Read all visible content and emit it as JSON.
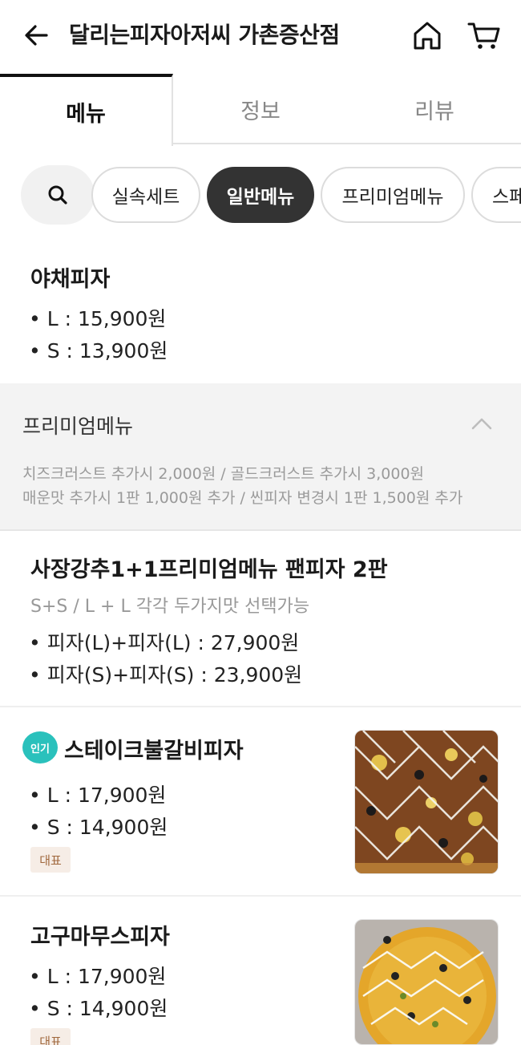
{
  "header": {
    "title": "달리는피자아저씨 가촌증산점",
    "back_icon": "arrow-left-icon",
    "home_icon": "home-icon",
    "cart_icon": "cart-icon"
  },
  "tabs": [
    {
      "label": "메뉴",
      "active": true
    },
    {
      "label": "정보",
      "active": false
    },
    {
      "label": "리뷰",
      "active": false
    }
  ],
  "chips": {
    "search_icon": "search-icon",
    "items": [
      {
        "label": "실속세트",
        "selected": false
      },
      {
        "label": "일반메뉴",
        "selected": true
      },
      {
        "label": "프리미엄메뉴",
        "selected": false
      },
      {
        "label": "스페",
        "selected": false
      }
    ]
  },
  "menu_top": {
    "name": "야채피자",
    "prices": [
      "• L : 15,900원",
      "• S : 13,900원"
    ]
  },
  "section": {
    "title": "프리미엄메뉴",
    "collapse_icon": "chevron-up-icon",
    "notes": [
      "치즈크러스트 추가시 2,000원 / 골드크러스트 추가시 3,000원",
      "매운맛 추가시 1판 1,000원 추가 / 씬피자 변경시 1판 1,500원 추가"
    ]
  },
  "items": [
    {
      "name": "사장강추1+1프리미엄메뉴 팬피자 2판",
      "desc": "S+S / L + L  각각 두가지맛 선택가능",
      "prices": [
        "• 피자(L)+피자(L) : 27,900원",
        "• 피자(S)+피자(S) : 23,900원"
      ]
    },
    {
      "badge": "인기",
      "name": "스테이크불갈비피자",
      "prices": [
        "• L : 17,900원",
        "• S : 14,900원"
      ],
      "tag": "대표"
    },
    {
      "name": "고구마무스피자",
      "prices": [
        "• L : 17,900원",
        "• S : 14,900원"
      ],
      "tag": "대표"
    }
  ],
  "colors": {
    "accent_teal": "#2ac1bc",
    "chip_selected": "#333333",
    "tag_bg": "#f6ede6",
    "tag_text": "#a0683d"
  }
}
